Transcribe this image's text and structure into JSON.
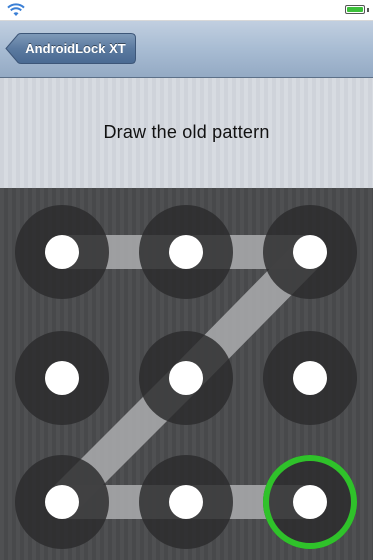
{
  "status_bar": {
    "wifi_icon": "wifi-icon",
    "battery_icon": "battery-icon",
    "battery_color": "#3cc03a"
  },
  "nav": {
    "back_label": "AndroidLock XT",
    "back_icon": "back-arrow-button"
  },
  "message": "Draw the old pattern",
  "pattern": {
    "grid_rows": 3,
    "grid_cols": 3,
    "path": [
      1,
      2,
      3,
      5,
      7,
      8,
      9
    ],
    "current_dot": 9,
    "highlight_color": "#2fc22a"
  }
}
